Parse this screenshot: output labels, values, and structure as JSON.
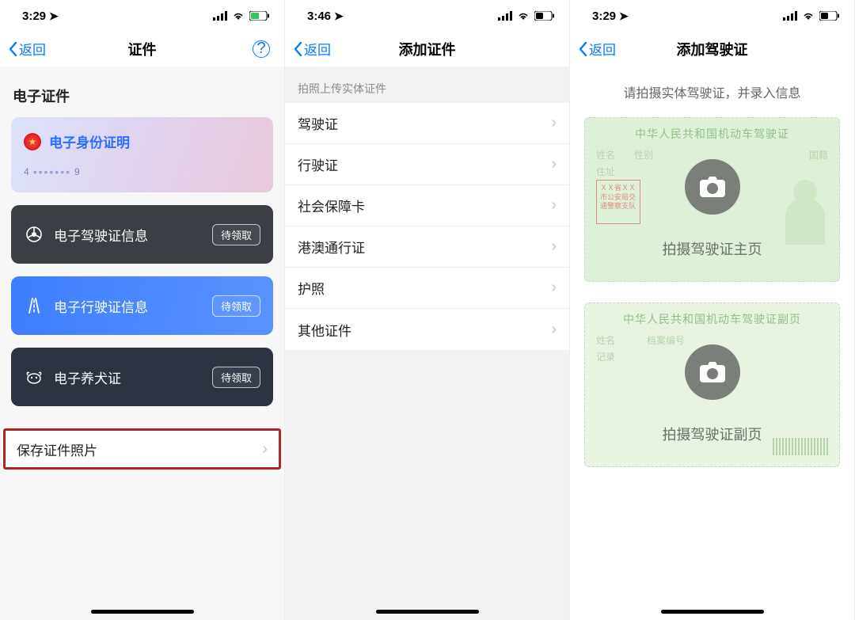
{
  "status": {
    "time1": "3:29",
    "time2": "3:46",
    "time3": "3:29"
  },
  "common": {
    "back_label": "返回"
  },
  "screen1": {
    "nav_title": "证件",
    "section_title": "电子证件",
    "card_id": {
      "label": "电子身份证明",
      "sub_prefix": "4",
      "sub_suffix": "9"
    },
    "card_drive": {
      "label": "电子驾驶证信息",
      "badge": "待领取"
    },
    "card_vehicle": {
      "label": "电子行驶证信息",
      "badge": "待领取"
    },
    "card_dog": {
      "label": "电子养犬证",
      "badge": "待领取"
    },
    "save_row": "保存证件照片"
  },
  "screen2": {
    "nav_title": "添加证件",
    "group_header": "拍照上传实体证件",
    "items": [
      {
        "label": "驾驶证"
      },
      {
        "label": "行驶证"
      },
      {
        "label": "社会保障卡"
      },
      {
        "label": "港澳通行证"
      },
      {
        "label": "护照"
      },
      {
        "label": "其他证件"
      }
    ]
  },
  "screen3": {
    "nav_title": "添加驾驶证",
    "hint": "请拍摄实体驾驶证，并录入信息",
    "front": {
      "title": "中华人民共和国机动车驾驶证",
      "fields": [
        "姓名",
        "性别",
        "国籍",
        "住址"
      ],
      "stamp": "ＸＸ省ＸＸ市公安局交通警察支队",
      "cam_label": "拍摄驾驶证主页"
    },
    "back": {
      "title": "中华人民共和国机动车驾驶证副页",
      "fields": [
        "姓名",
        "档案编号",
        "记录"
      ],
      "cam_label": "拍摄驾驶证副页"
    }
  }
}
